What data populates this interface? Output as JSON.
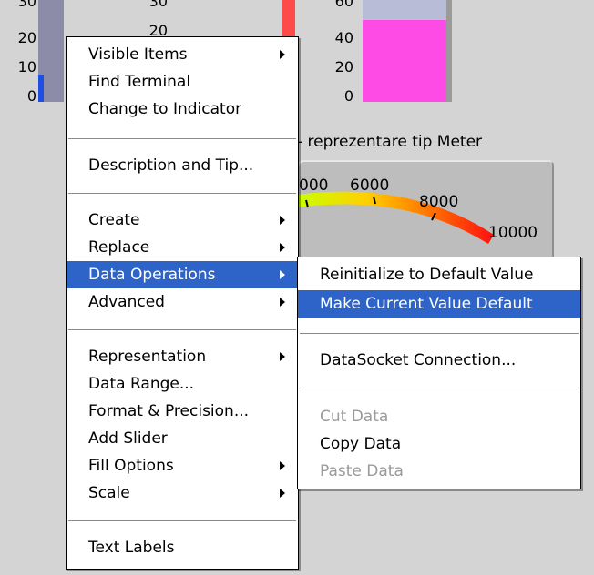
{
  "scales": {
    "left": [
      "30",
      "20",
      "10",
      "0"
    ],
    "mid": [
      "30",
      "20"
    ],
    "right": [
      "60",
      "40",
      "20",
      "0"
    ]
  },
  "meter": {
    "title": "- reprezentare tip Meter",
    "labels": [
      "000",
      "6000",
      "8000",
      "10000"
    ]
  },
  "context_menu": {
    "group1": [
      "Visible Items",
      "Find Terminal",
      "Change to Indicator"
    ],
    "group2": [
      "Description and Tip..."
    ],
    "group3": [
      "Create",
      "Replace",
      "Data Operations",
      "Advanced"
    ],
    "group4": [
      "Representation",
      "Data Range...",
      "Format & Precision...",
      "Add Slider",
      "Fill Options",
      "Scale"
    ],
    "group5": [
      "Text Labels"
    ]
  },
  "submenu": {
    "group1": [
      "Reinitialize to Default Value",
      "Make Current Value Default"
    ],
    "group2": [
      "DataSocket Connection..."
    ],
    "group3": [
      "Cut Data",
      "Copy Data",
      "Paste Data"
    ]
  },
  "colors": {
    "highlight": "#2e64c8",
    "tank_fill": "#ff4be6",
    "slider_red": "#ff4a4a",
    "slider_blue": "#1e4fe0",
    "disabled_text": "#9a9a9a"
  }
}
